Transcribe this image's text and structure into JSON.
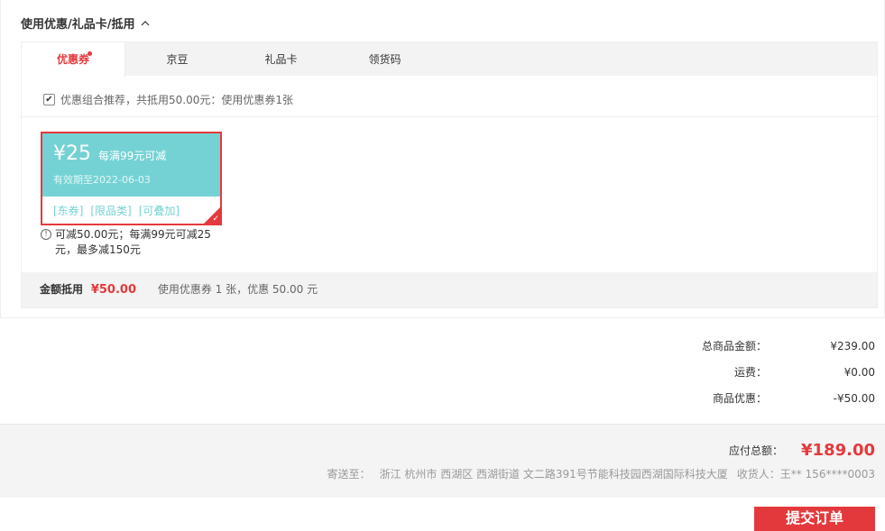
{
  "section": {
    "title": "使用优惠/礼品卡/抵用",
    "toggle_icon": "chevron-up-icon"
  },
  "tabs": [
    {
      "label": "优惠券",
      "active": true,
      "has_dot": true
    },
    {
      "label": "京豆"
    },
    {
      "label": "礼品卡"
    },
    {
      "label": "领货码"
    }
  ],
  "recommend": {
    "checked": true,
    "text": "优惠组合推荐，共抵用50.00元：使用优惠券1张"
  },
  "coupon": {
    "amount": "¥25",
    "condition": "每满99元可减",
    "valid": "有效期至2022-06-03",
    "tags": [
      "[东券]",
      "[限品类]",
      "[可叠加]"
    ],
    "selected": true,
    "note": "可减50.00元；每满99元可减25元，最多减150元"
  },
  "summary": {
    "label": "金额抵用",
    "value": "¥50.00",
    "text": "使用优惠券 1 张，优惠 50.00 元"
  },
  "totals": [
    {
      "label": "总商品金额：",
      "value": "¥239.00"
    },
    {
      "label": "运费：",
      "value": "¥0.00"
    },
    {
      "label": "商品优惠：",
      "value": "-¥50.00"
    }
  ],
  "payable": {
    "label": "应付总额：",
    "value": "¥189.00"
  },
  "shipping": {
    "label": "寄送至：",
    "address": "浙江 杭州市 西湖区 西湖街道 文二路391号节能科技园西湖国际科技大厦",
    "receiver": "收货人：王** 156****0003"
  },
  "submit": {
    "label": "提交订单"
  },
  "colors": {
    "accent": "#e4393c",
    "coupon": "#74d2d4"
  }
}
